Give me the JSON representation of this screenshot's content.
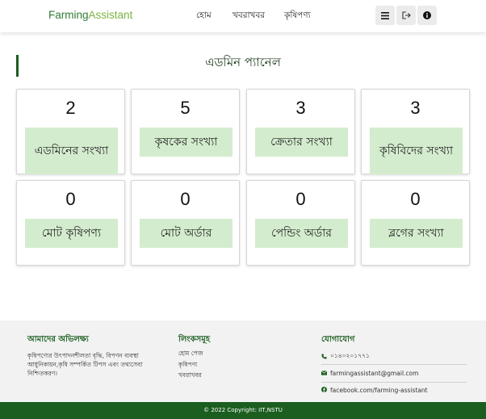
{
  "navbar": {
    "brand_part1": "Farming",
    "brand_part2": "Assistant",
    "links": [
      "হোম",
      "খবরাখবর",
      "কৃষিপণ্য"
    ],
    "icons": [
      "menu-icon",
      "logout-icon",
      "info-icon"
    ]
  },
  "page_title": "এডমিন প্যানেল",
  "stats": [
    {
      "value": "2",
      "label": "এডমিনের সংখ্যা"
    },
    {
      "value": "5",
      "label": "কৃষকের সংখ্যা"
    },
    {
      "value": "3",
      "label": "ক্রেতার সংখ্যা"
    },
    {
      "value": "3",
      "label": "কৃষিবিদের সংখ্যা"
    },
    {
      "value": "0",
      "label": "মোট কৃষিপণ্য"
    },
    {
      "value": "0",
      "label": "মোট অর্ডার"
    },
    {
      "value": "0",
      "label": "পেন্ডিং অর্ডার"
    },
    {
      "value": "0",
      "label": "ব্লগের সংখ্যা"
    }
  ],
  "footer": {
    "about_heading": "আমাদের অভিলক্ষ্য",
    "about_text": "কৃষিপণ্যের উৎপাদনশীলতা বৃদ্ধি, বিপণন ব্যবস্থা আধুনিকায়ন,কৃষি সম্পর্কিত টিপস এবং তথ্যসেবা নিশ্চিতকরণ।",
    "links_heading": "লিংকসমূহ",
    "links": [
      "হোম পেজ",
      "কৃষিপণ্য",
      "খবরাখবর"
    ],
    "contact_heading": "যোগাযোগ",
    "phone": "০১৪০২০১৭৭১",
    "email": "farmingassistant@gmail.com",
    "facebook": "facebook.com/farming-assistant"
  },
  "copyright": "© 2022 Copyright: IIT,NSTU",
  "colors": {
    "primary": "#1b5e20",
    "brand_light": "#7cb342",
    "card_label_bg": "#d4ecce"
  }
}
